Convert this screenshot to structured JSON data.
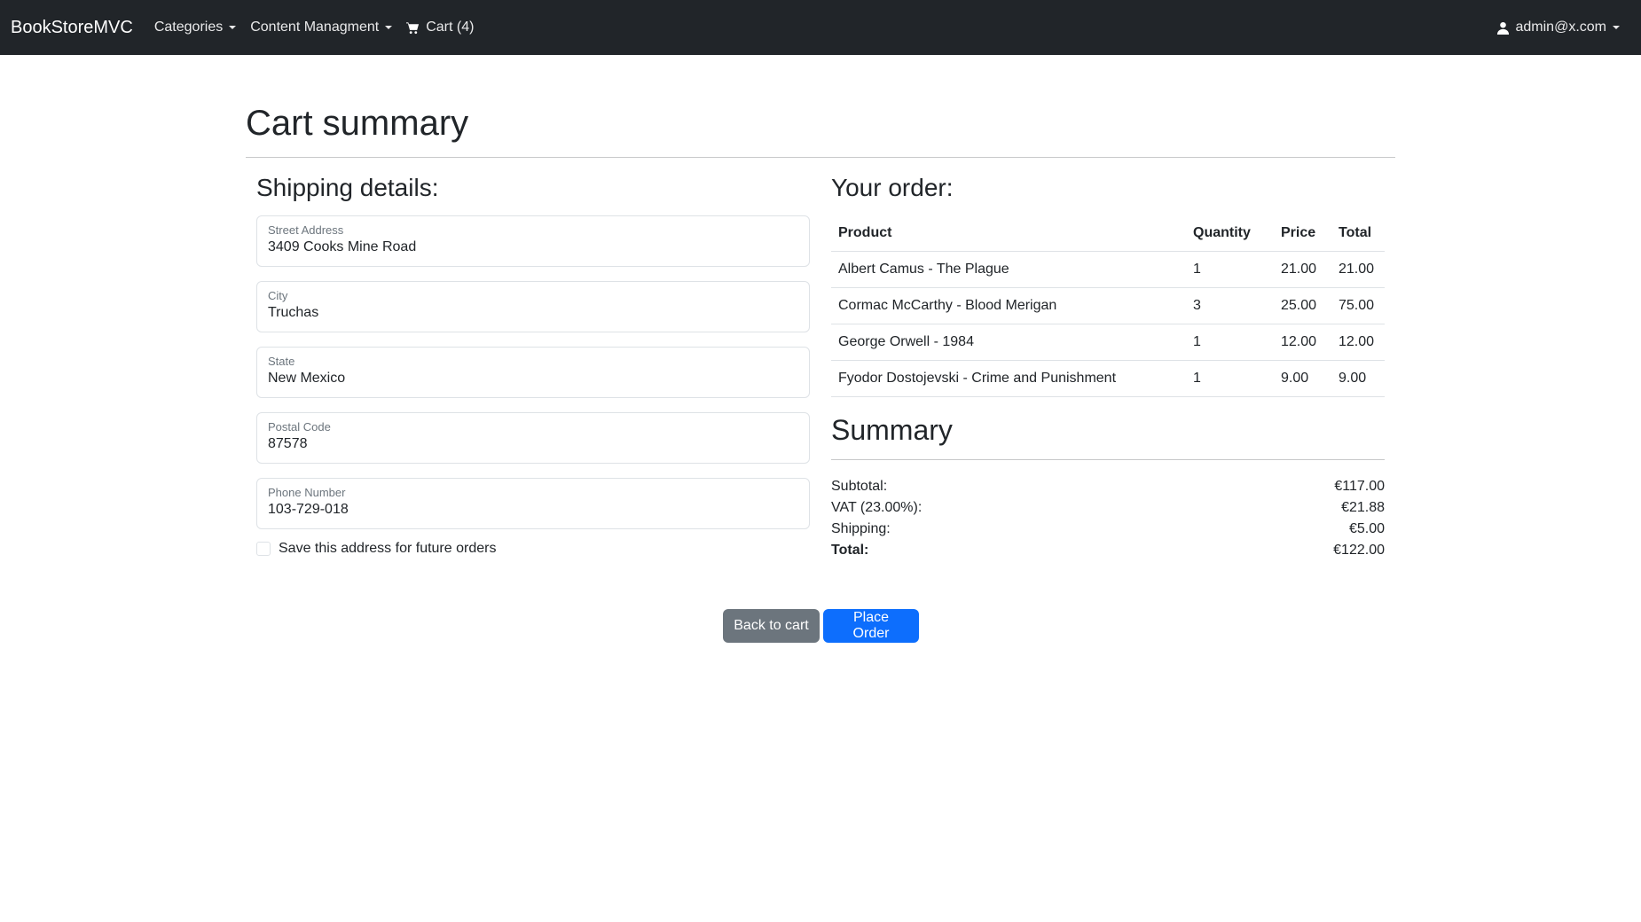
{
  "navbar": {
    "brand": "BookStoreMVC",
    "items": [
      {
        "label": "Categories",
        "dropdown": true
      },
      {
        "label": "Content Managment",
        "dropdown": true
      }
    ],
    "cart_label": "Cart (4)",
    "cart_icon": "cart-icon",
    "user_label": "admin@x.com",
    "user_icon": "user-icon"
  },
  "page": {
    "title": "Cart summary"
  },
  "shipping": {
    "heading": "Shipping details:",
    "fields": [
      {
        "label": "Street Address",
        "value": "3409 Cooks Mine Road"
      },
      {
        "label": "City",
        "value": "Truchas"
      },
      {
        "label": "State",
        "value": "New Mexico"
      },
      {
        "label": "Postal Code",
        "value": "87578"
      },
      {
        "label": "Phone Number",
        "value": "103-729-018"
      }
    ],
    "save_label": "Save this address for future orders",
    "save_checked": false
  },
  "order": {
    "heading": "Your order:",
    "columns": [
      "Product",
      "Quantity",
      "Price",
      "Total"
    ],
    "rows": [
      {
        "product": "Albert Camus - The Plague",
        "quantity": "1",
        "price": "21.00",
        "total": "21.00"
      },
      {
        "product": "Cormac McCarthy - Blood Merigan",
        "quantity": "3",
        "price": "25.00",
        "total": "75.00"
      },
      {
        "product": "George Orwell - 1984",
        "quantity": "1",
        "price": "12.00",
        "total": "12.00"
      },
      {
        "product": "Fyodor Dostojevski - Crime and Punishment",
        "quantity": "1",
        "price": "9.00",
        "total": "9.00"
      }
    ]
  },
  "summary": {
    "heading": "Summary",
    "subtotal_label": "Subtotal:",
    "subtotal": "€117.00",
    "vat_label": "VAT (23.00%):",
    "vat": "€21.88",
    "shipping_label": "Shipping:",
    "shipping": "€5.00",
    "total_label": "Total:",
    "total": "€122.00"
  },
  "actions": {
    "back_label": "Back to cart",
    "place_label": "Place Order"
  },
  "colors": {
    "navbar_bg": "#212529",
    "primary": "#0d6efd",
    "secondary": "#6c757d"
  }
}
